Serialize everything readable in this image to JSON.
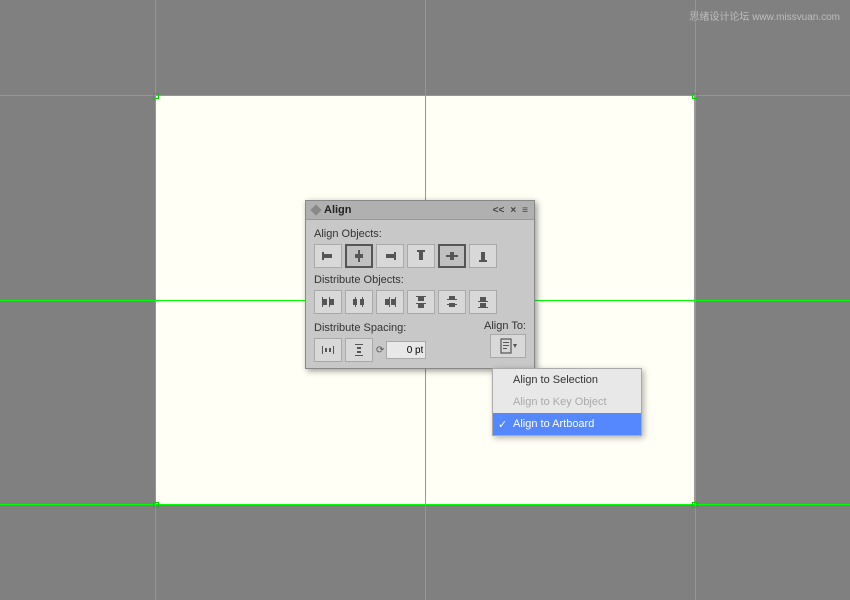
{
  "watermark": {
    "text": "思绪设计论坛 www.missvuan.com"
  },
  "panel": {
    "title": "Align",
    "collapse_label": "<<",
    "close_label": "×",
    "menu_label": "≡",
    "align_objects_label": "Align Objects:",
    "distribute_objects_label": "Distribute Objects:",
    "distribute_spacing_label": "Distribute Spacing:",
    "align_to_label": "Align To:",
    "spacing_value": "0 pt"
  },
  "dropdown": {
    "items": [
      {
        "id": "align-to-selection",
        "label": "Align to Selection",
        "checked": false,
        "disabled": false
      },
      {
        "id": "align-to-key-object",
        "label": "Align to Key Object",
        "checked": false,
        "disabled": true
      },
      {
        "id": "align-to-artboard",
        "label": "Align to Artboard",
        "checked": true,
        "disabled": false
      }
    ]
  }
}
